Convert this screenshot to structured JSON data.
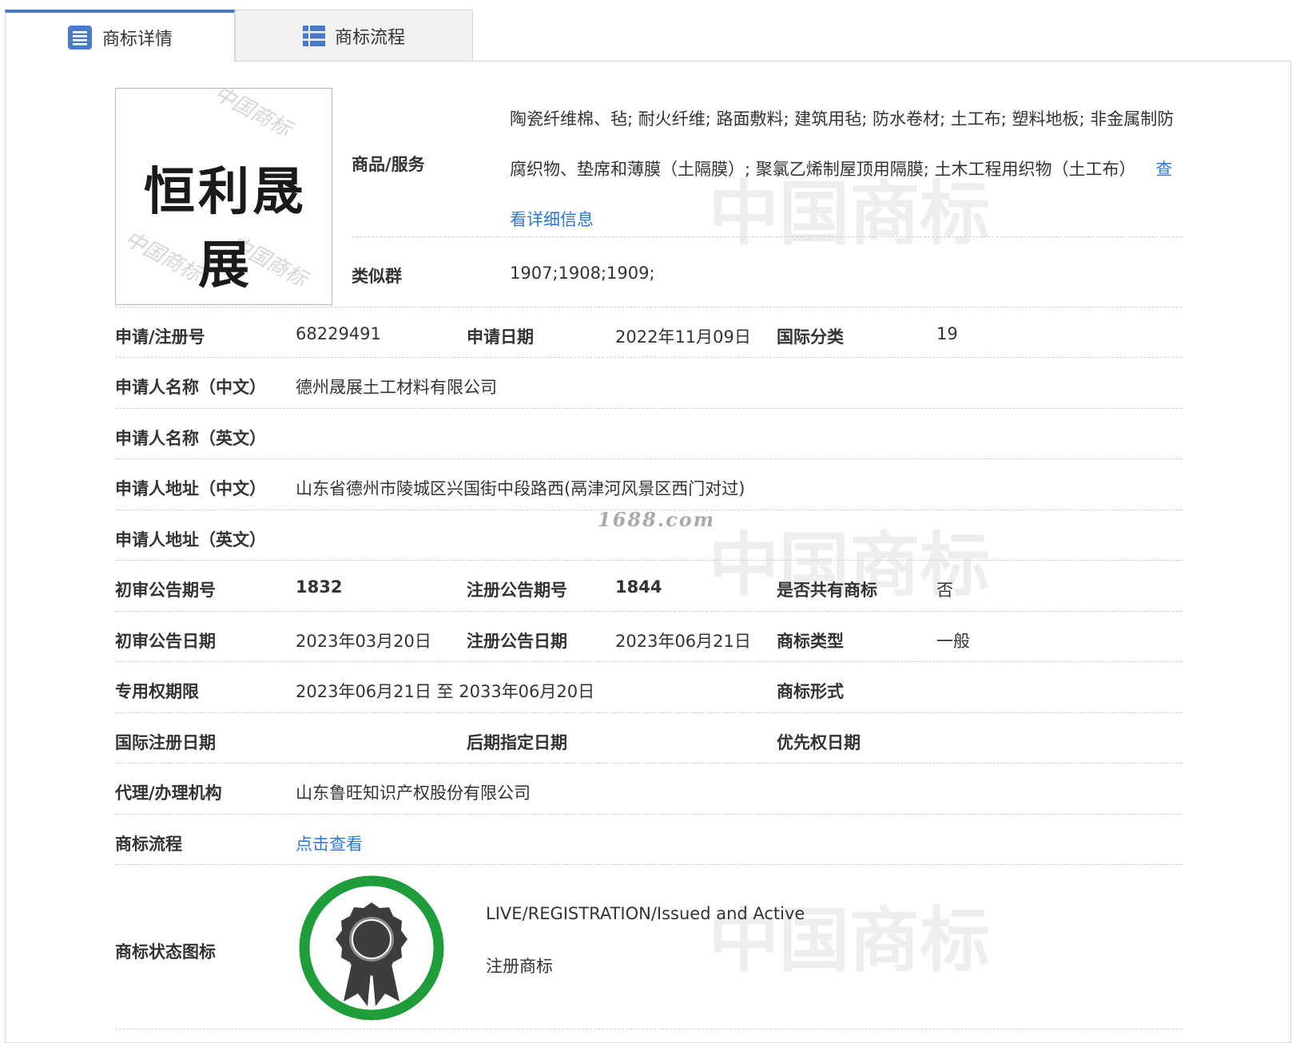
{
  "tabs": {
    "detail": "商标详情",
    "flow": "商标流程"
  },
  "logo": {
    "text": "恒利晟展",
    "watermark": "中国商标"
  },
  "goods": {
    "label": "商品/服务",
    "text": "陶瓷纤维棉、毡; 耐火纤维; 路面敷料; 建筑用毡; 防水卷材; 土工布; 塑料地板; 非金属制防腐织物、垫席和薄膜（土隔膜）; 聚氯乙烯制屋顶用隔膜; 土木工程用织物（土工布）",
    "link": "查看详细信息"
  },
  "similar": {
    "label": "类似群",
    "value": "1907;1908;1909;"
  },
  "reg_no": {
    "label": "申请/注册号",
    "value": "68229491"
  },
  "apply_date": {
    "label": "申请日期",
    "value": "2022年11月09日"
  },
  "intl_class": {
    "label": "国际分类",
    "value": "19"
  },
  "applicant_cn": {
    "label": "申请人名称（中文）",
    "value": "德州晟展土工材料有限公司"
  },
  "applicant_en": {
    "label": "申请人名称（英文）",
    "value": ""
  },
  "address_cn": {
    "label": "申请人地址（中文）",
    "value": "山东省德州市陵城区兴国街中段路西(鬲津河风景区西门对过)"
  },
  "address_en": {
    "label": "申请人地址（英文）",
    "value": ""
  },
  "prelim_issue": {
    "label": "初审公告期号",
    "value": "1832"
  },
  "reg_issue": {
    "label": "注册公告期号",
    "value": "1844"
  },
  "shared": {
    "label": "是否共有商标",
    "value": "否"
  },
  "prelim_date": {
    "label": "初审公告日期",
    "value": "2023年03月20日"
  },
  "reg_date": {
    "label": "注册公告日期",
    "value": "2023年06月21日"
  },
  "tm_type": {
    "label": "商标类型",
    "value": "一般"
  },
  "term": {
    "label": "专用权期限",
    "value": "2023年06月21日 至 2033年06月20日"
  },
  "tm_form": {
    "label": "商标形式",
    "value": ""
  },
  "intl_reg_date": {
    "label": "国际注册日期",
    "value": ""
  },
  "later_date": {
    "label": "后期指定日期",
    "value": ""
  },
  "priority_date": {
    "label": "优先权日期",
    "value": ""
  },
  "agent": {
    "label": "代理/办理机构",
    "value": "山东鲁旺知识产权股份有限公司"
  },
  "flow": {
    "label": "商标流程",
    "link": "点击查看"
  },
  "status": {
    "label": "商标状态图标",
    "line1": "LIVE/REGISTRATION/Issued and Active",
    "line2": "注册商标",
    "icon": "award-ribbon-icon"
  },
  "site_watermark": "1688.com",
  "background_watermark": "中国商标",
  "colors": {
    "tab_accent": "#4a79c9",
    "link": "#2b7bd6",
    "status_ring": "#1f9d3a",
    "medal": "#3d3d3d"
  }
}
